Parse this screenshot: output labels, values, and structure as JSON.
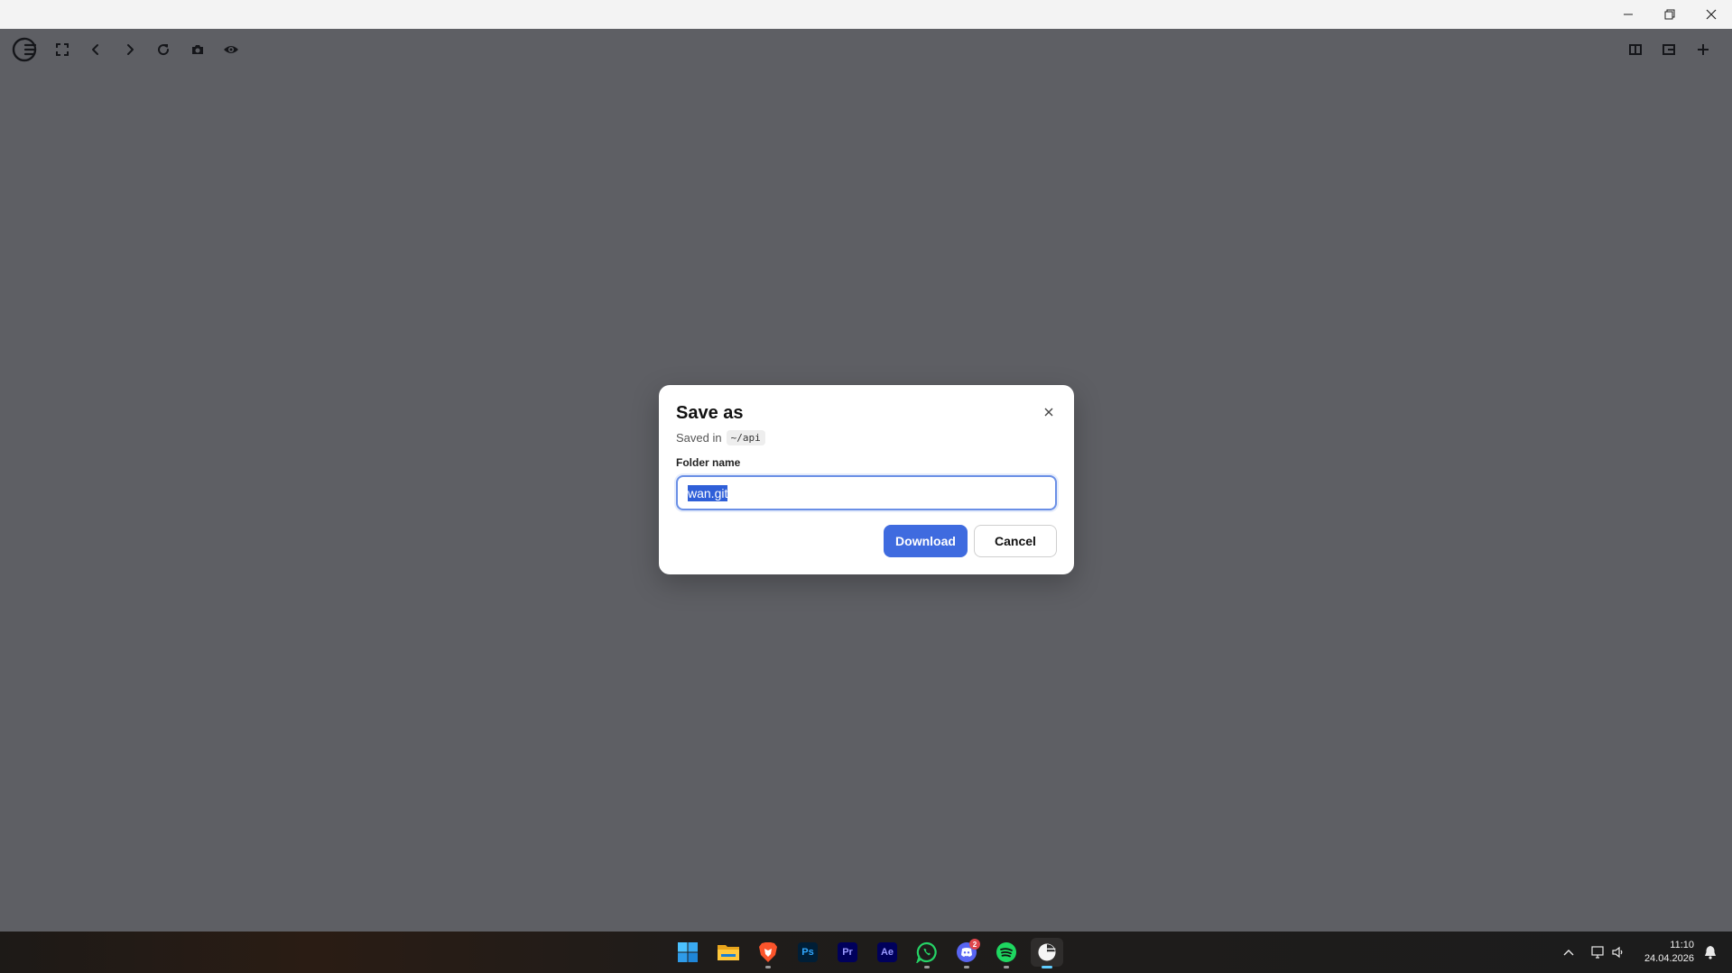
{
  "window": {
    "controls": [
      "minimize-icon",
      "restore-icon",
      "close-icon"
    ]
  },
  "toolbar": {
    "left_icons": [
      "app-logo-icon",
      "fullscreen-icon",
      "back-icon",
      "forward-icon",
      "reload-icon",
      "screenshot-icon",
      "eye-icon"
    ],
    "right_icons": [
      "split-view-icon",
      "panel-icon",
      "plus-icon"
    ]
  },
  "dialog": {
    "title": "Save as",
    "subtitle_prefix": "Saved in",
    "path": "~/api",
    "field_label": "Folder name",
    "field_value": "wan.git",
    "primary_button": "Download",
    "secondary_button": "Cancel",
    "accent_color": "#3f6bdf"
  },
  "taskbar": {
    "apps": [
      {
        "name": "start-icon"
      },
      {
        "name": "file-explorer-icon"
      },
      {
        "name": "brave-browser-icon",
        "running": true
      },
      {
        "name": "photoshop-icon",
        "label": "Ps"
      },
      {
        "name": "premiere-pro-icon",
        "label": "Pr"
      },
      {
        "name": "after-effects-icon",
        "label": "Ae"
      },
      {
        "name": "whatsapp-icon",
        "running": true
      },
      {
        "name": "discord-icon",
        "running": true,
        "badge": "2"
      },
      {
        "name": "spotify-icon",
        "running": true
      },
      {
        "name": "app-active-icon",
        "running": true,
        "active": true
      }
    ],
    "clock": {
      "time": "11:10",
      "date": "24.04.2026"
    }
  }
}
